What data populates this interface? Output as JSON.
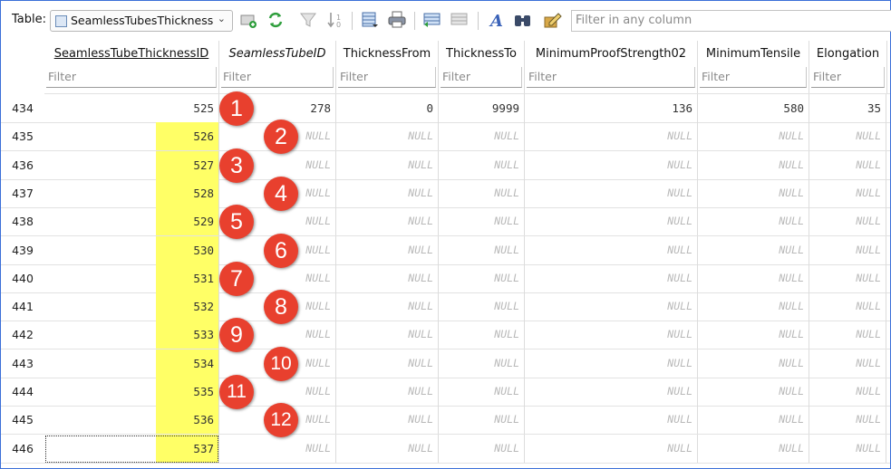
{
  "toolbar": {
    "table_label": "Table:",
    "table_name": "SeamlessTubesThickness",
    "filter_placeholder": "Filter in any column"
  },
  "columns": [
    {
      "name": "SeamlessTubeThicknessID",
      "filter": "Filter"
    },
    {
      "name": "SeamlessTubeID",
      "filter": "Filter"
    },
    {
      "name": "ThicknessFrom",
      "filter": "Filter"
    },
    {
      "name": "ThicknessTo",
      "filter": "Filter"
    },
    {
      "name": "MinimumProofStrength02",
      "filter": "Filter"
    },
    {
      "name": "MinimumTensile",
      "filter": "Filter"
    },
    {
      "name": "Elongation",
      "filter": "Filter"
    }
  ],
  "rows": [
    {
      "num": "434",
      "cells": [
        "525",
        "278",
        "0",
        "9999",
        "136",
        "580",
        "35"
      ]
    },
    {
      "num": "435",
      "cells": [
        "526",
        "NULL",
        "NULL",
        "NULL",
        "NULL",
        "NULL",
        "NULL"
      ]
    },
    {
      "num": "436",
      "cells": [
        "527",
        "NULL",
        "NULL",
        "NULL",
        "NULL",
        "NULL",
        "NULL"
      ]
    },
    {
      "num": "437",
      "cells": [
        "528",
        "NULL",
        "NULL",
        "NULL",
        "NULL",
        "NULL",
        "NULL"
      ]
    },
    {
      "num": "438",
      "cells": [
        "529",
        "NULL",
        "NULL",
        "NULL",
        "NULL",
        "NULL",
        "NULL"
      ]
    },
    {
      "num": "439",
      "cells": [
        "530",
        "NULL",
        "NULL",
        "NULL",
        "NULL",
        "NULL",
        "NULL"
      ]
    },
    {
      "num": "440",
      "cells": [
        "531",
        "NULL",
        "NULL",
        "NULL",
        "NULL",
        "NULL",
        "NULL"
      ]
    },
    {
      "num": "441",
      "cells": [
        "532",
        "NULL",
        "NULL",
        "NULL",
        "NULL",
        "NULL",
        "NULL"
      ]
    },
    {
      "num": "442",
      "cells": [
        "533",
        "NULL",
        "NULL",
        "NULL",
        "NULL",
        "NULL",
        "NULL"
      ]
    },
    {
      "num": "443",
      "cells": [
        "534",
        "NULL",
        "NULL",
        "NULL",
        "NULL",
        "NULL",
        "NULL"
      ]
    },
    {
      "num": "444",
      "cells": [
        "535",
        "NULL",
        "NULL",
        "NULL",
        "NULL",
        "NULL",
        "NULL"
      ]
    },
    {
      "num": "445",
      "cells": [
        "536",
        "NULL",
        "NULL",
        "NULL",
        "NULL",
        "NULL",
        "NULL"
      ]
    },
    {
      "num": "446",
      "cells": [
        "537",
        "NULL",
        "NULL",
        "NULL",
        "NULL",
        "NULL",
        "NULL"
      ]
    }
  ],
  "badges": [
    "1",
    "2",
    "3",
    "4",
    "5",
    "6",
    "7",
    "8",
    "9",
    "10",
    "11",
    "12"
  ],
  "colors": {
    "highlight": "#ffff66",
    "badge": "#e8402e",
    "frame": "#3a6fd8"
  }
}
